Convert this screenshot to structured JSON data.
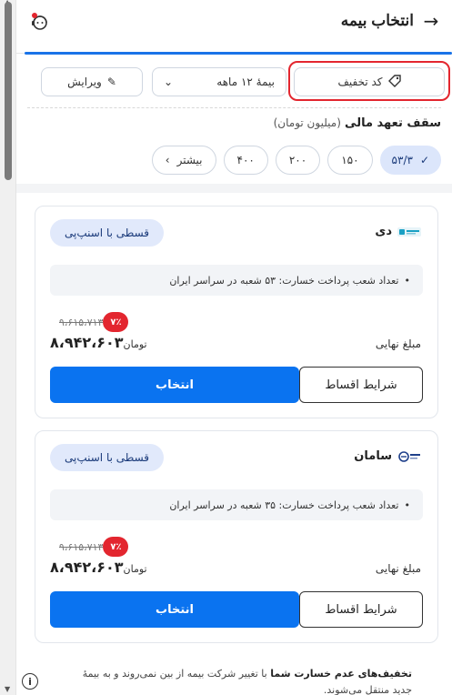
{
  "header": {
    "title": "انتخاب بیمه",
    "back_icon": "arrow-right-icon",
    "support_icon": "support-agent-icon"
  },
  "filters": {
    "discount_label": "کد تخفیف",
    "month_label": "بیمهٔ ۱۲ ماهه",
    "edit_label": "ویرایش"
  },
  "coverage": {
    "title": "سقف تعهد مالی",
    "subtitle": "(میلیون تومان)",
    "options": [
      "۵۳/۳",
      "۱۵۰",
      "۲۰۰",
      "۴۰۰"
    ],
    "more_label": "بیشتر"
  },
  "cards": [
    {
      "brand": "دی",
      "badge": "قسطی با اسنپ‌پی",
      "info": "تعداد شعب پرداخت خسارت: ۵۳ شعبه در سراسر ایران",
      "discount_pct": "۷٪",
      "old_price": "۹،۶۱۵،۷۱۳",
      "final_label": "مبلغ نهایی",
      "final_price": "۸،۹۴۲،۶۰۳",
      "unit": "تومان",
      "select_label": "انتخاب",
      "terms_label": "شرایط اقساط"
    },
    {
      "brand": "سامان",
      "badge": "قسطی با اسنپ‌پی",
      "info": "تعداد شعب پرداخت خسارت: ۳۵ شعبه در سراسر ایران",
      "discount_pct": "۷٪",
      "old_price": "۹،۶۱۵،۷۱۳",
      "final_label": "مبلغ نهایی",
      "final_price": "۸،۹۴۲،۶۰۳",
      "unit": "تومان",
      "select_label": "انتخاب",
      "terms_label": "شرایط اقساط"
    }
  ],
  "footer": {
    "bold": "تخفیف‌های عدم خسارت شما",
    "text": " با تغییر شرکت بیمه از بین نمی‌روند و به بیمهٔ جدید منتقل می‌شوند."
  },
  "colors": {
    "primary": "#0a73f0",
    "highlight": "#e3262f",
    "chip_active": "#dce6fb"
  }
}
